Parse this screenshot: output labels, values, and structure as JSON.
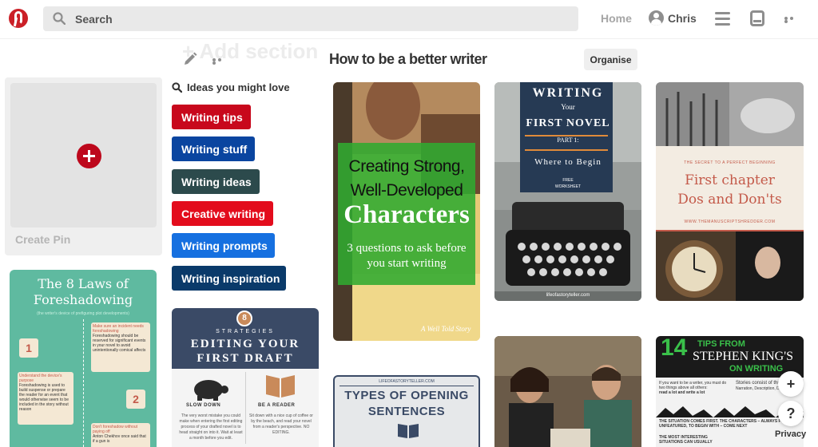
{
  "search": {
    "placeholder": "Search",
    "icon": "search-icon"
  },
  "nav": {
    "home": "Home",
    "user_name": "Chris"
  },
  "board": {
    "add_section": "+ Add section",
    "title": "How to be a better writer",
    "organise_label": "Organise"
  },
  "create_pin": {
    "label": "Create Pin"
  },
  "ideas": {
    "header": "Ideas you might love",
    "chips": [
      {
        "label": "Writing tips",
        "color": "#c8081c"
      },
      {
        "label": "Writing stuff",
        "color": "#0a45a0"
      },
      {
        "label": "Writing ideas",
        "color": "#2c4a4c"
      },
      {
        "label": "Creative writing",
        "color": "#e30c1c"
      },
      {
        "label": "Writing prompts",
        "color": "#1670e0"
      },
      {
        "label": "Writing inspiration",
        "color": "#0a3a6a"
      }
    ]
  },
  "pins": {
    "characters": {
      "line1": "Creating Strong,",
      "line2": "Well-Developed",
      "line3": "Characters",
      "line4": "3 questions to ask before",
      "line5": "you start writing",
      "watermark": "A Well Told Story"
    },
    "first_novel": {
      "line1": "WRITING",
      "line2": "Your",
      "line3": "FIRST NOVEL",
      "line4": "PART 1:",
      "line5": "Where to Begin",
      "line6": "FREE",
      "line7": "WORKSHEET",
      "footer": "lifeofastoryteller.com"
    },
    "first_chapter": {
      "kicker": "THE SECRET TO A PERFECT BEGINNING",
      "line1": "First chapter",
      "line2": "Dos and Don'ts",
      "site": "WWW.THEMANUSCRIPTSHREDDER.COM"
    },
    "foreshadowing": {
      "line1": "The 8 Laws of",
      "line2": "Foreshadowing",
      "subtitle": "(the writer's device of prefiguring plot developments)",
      "law1_num": "1",
      "law1_title": "Make sure an incident needs foreshadowing",
      "law1_body": "Foreshadowing should be reserved for significant events in your novel to avoid unintentionally comical affects",
      "law2_num": "2",
      "law2_title": "Understand the device's purpose",
      "law2_body": "Foreshadowing is used to build suspense or prepare the reader for an event that would otherwise seem to be included in the story without reason",
      "law3_title": "Don't foreshadow without paying off",
      "law3_body": "Anton Chekhov once said that if a gun is"
    },
    "editing": {
      "badge": "8",
      "line1": "STRATEGIES",
      "line2": "EDITING YOUR",
      "line3": "FIRST DRAFT",
      "left_label": "SLOW DOWN",
      "right_label": "BE A READER",
      "left_body": "The very worst mistake you could make when entering the first editing process of your drafted novel is to head straight on into it. Wait at least a month before you edit.",
      "right_body": "Sit down with a nice cup of coffee or by the beach, and read your novel from a reader's perspective. NO EDITING."
    },
    "opening": {
      "site": "LIFEOFASTORYTELLER.COM",
      "line1": "TYPES OF OPENING",
      "line2": "SENTENCES"
    },
    "king": {
      "num": "14",
      "line1": "TIPS FROM",
      "line2": "STEPHEN KING'S",
      "line3": "ON WRITING",
      "tip1": "If you want to be a writer, you must do two things above all others:",
      "tip1b": "read a lot and write a lot",
      "tip2": "Stories consist of three parts:",
      "tip2b": "Narration, Description, Dialogue",
      "tip3": "THE SITUATION COMES FIRST. THE CHARACTERS – ALWAYS FLAT AND UNFEATURED, TO BEGIN WITH – COME NEXT",
      "tip4": "THE MOST INTERESTING SITUATIONS CAN USUALLY"
    }
  },
  "floating": {
    "plus": "+",
    "help": "?",
    "privacy": "Privacy"
  }
}
